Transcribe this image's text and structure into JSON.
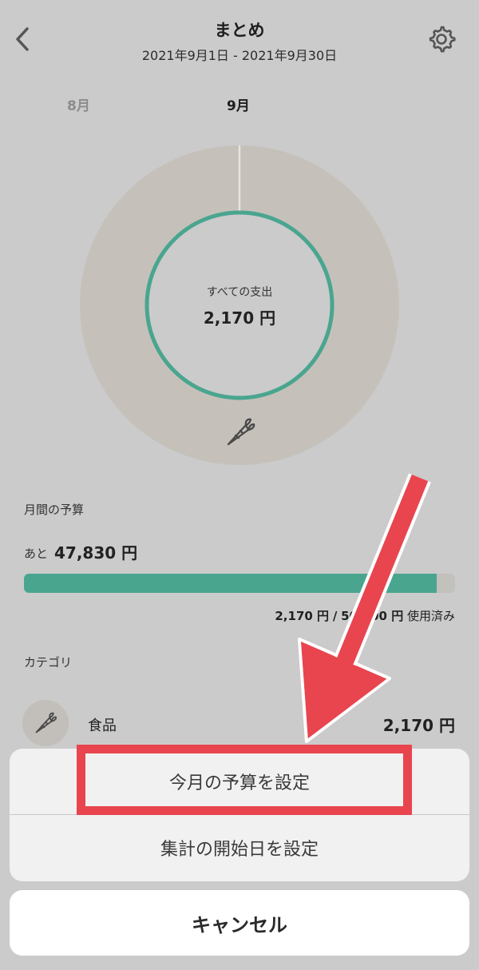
{
  "header": {
    "title": "まとめ",
    "date_range": "2021年9月1日 - 2021年9月30日"
  },
  "tabs": {
    "prev": "8月",
    "current": "9月"
  },
  "donut": {
    "label": "すべての支出",
    "value": "2,170 円",
    "segments": [
      {
        "name": "食品",
        "fraction": 1.0,
        "color": "#c5c1ba"
      }
    ],
    "ring_color": "#4aa58f",
    "category_icon": "carrot-icon"
  },
  "budget": {
    "label": "月間の予算",
    "remaining_prefix": "あと",
    "remaining_value": "47,830 円",
    "used_fraction": 0.957,
    "used": "2,170 円",
    "separator": "/",
    "total": "50,000 円",
    "used_suffix": "使用済み",
    "bar_color": "#4aa58f"
  },
  "categories": {
    "header": "カテゴリ",
    "items": [
      {
        "icon": "carrot-icon",
        "name": "食品",
        "amount": "2,170 円"
      }
    ]
  },
  "action_sheet": {
    "set_budget": "今月の予算を設定",
    "set_start_date": "集計の開始日を設定",
    "cancel": "キャンセル"
  },
  "annotations": {
    "highlight_color": "#e8454e"
  }
}
